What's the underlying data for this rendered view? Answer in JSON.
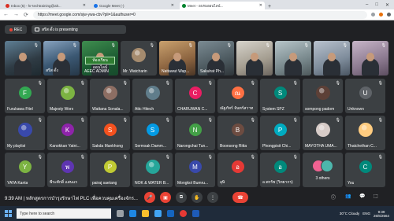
{
  "browser": {
    "tabs": [
      {
        "title": "Inbox (5) - hr-techtraining@alt...",
        "fav_color": "#d93025",
        "active": false
      },
      {
        "title": "Google Meet (-)",
        "fav_color": "#1a73e8",
        "active": false
      },
      {
        "title": "Meet - อบรมออนไลน์...",
        "fav_color": "#00832d",
        "active": true
      }
    ],
    "new_tab_label": "+",
    "window_controls": [
      "–",
      "□",
      "✕"
    ],
    "url": "https://meet.google.com/sjw-ywa-cbv?pli=1&authuser=0"
  },
  "presenting": {
    "rec_label": "REC",
    "presenter_text": "สรีส ดั้ง is presenting"
  },
  "grid": {
    "row1": [
      {
        "name": "",
        "video": "v1"
      },
      {
        "name": "สรีส ดั้ง",
        "video": "v2"
      },
      {
        "name": "AEEC ADMIN",
        "video": "v3",
        "banner": "ห้องเรียนออนไลน์"
      },
      {
        "name": "Mr. Watcharin",
        "avatar_letter": "",
        "photo_color": "#a58b6e"
      },
      {
        "name": "Nattawut Wap...",
        "video": "v4"
      },
      {
        "name": "Sakulrat Ph...",
        "video": "v5"
      },
      {
        "name": "",
        "video": "v6"
      },
      {
        "name": "",
        "video": "v7"
      },
      {
        "name": "",
        "video": "v8"
      },
      {
        "name": "",
        "video": "v9"
      }
    ],
    "row2": [
      {
        "name": "Furukawa Fitel",
        "avatar_letter": "F",
        "color": "#33a852"
      },
      {
        "name": "Majesty Worx",
        "photo_color": "#7cb342"
      },
      {
        "name": "Wattana Sonala...",
        "photo_color": "#8d6e63"
      },
      {
        "name": "Attc Hitech",
        "photo_color": "#607d8b"
      },
      {
        "name": "CHARUWAN C...",
        "avatar_letter": "C",
        "color": "#e91e63"
      },
      {
        "name": "ณัฐภัทร์ จันทร์สวาท",
        "avatar_letter": "ณ",
        "color": "#ff7043"
      },
      {
        "name": "System SPZ",
        "avatar_letter": "S",
        "color": "#00897b"
      },
      {
        "name": "sompong padom",
        "photo_color": "#5d4037"
      },
      {
        "name": "Unknown",
        "avatar_letter": "U",
        "color": "#5f6368"
      }
    ],
    "row3": [
      {
        "name": "My playlist",
        "photo_color": "#3949ab"
      },
      {
        "name": "Kanokkan Yatni...",
        "avatar_letter": "K",
        "color": "#8e24aa"
      },
      {
        "name": "Sakda Mankhong",
        "avatar_letter": "S",
        "color": "#f4511e"
      },
      {
        "name": "Sermsak Damm...",
        "avatar_letter": "S",
        "color": "#039be5"
      },
      {
        "name": "Narongchai Tun...",
        "avatar_letter": "N",
        "color": "#43a047"
      },
      {
        "name": "Boonsong Ritta",
        "avatar_letter": "B",
        "color": "#6d4c41"
      },
      {
        "name": "Phongpisit Chi...",
        "avatar_letter": "P",
        "color": "#00acc1"
      },
      {
        "name": "MAYOTHA UMA...",
        "photo_color": "#d7ccc8"
      },
      {
        "name": "Thatchethan C...",
        "photo_color": "#ffcc80"
      }
    ],
    "row4": [
      {
        "name": "YAYA Kanta",
        "avatar_letter": "Y",
        "color": "#7cb342"
      },
      {
        "name": "พีระศักดิ์ แสนแร",
        "avatar_letter": "พ",
        "color": "#5e35b1"
      },
      {
        "name": "pairaj saetang",
        "avatar_letter": "P",
        "color": "#c0ca33"
      },
      {
        "name": "NOK & WATER B...",
        "photo_color": "#26a69a"
      },
      {
        "name": "Mongkol Bumru...",
        "avatar_letter": "M",
        "color": "#3949ab"
      },
      {
        "name": "อุษิ",
        "avatar_letter": "อ",
        "color": "#e53935"
      },
      {
        "name": "อ.พรรัช (วิทยากร)",
        "avatar_letter": "อ",
        "color": "#00897b"
      },
      {
        "name": "3 others",
        "others": true
      },
      {
        "name": "You",
        "avatar_letter": "C",
        "color": "#00897b"
      }
    ]
  },
  "bottom": {
    "time_meeting": "9:39 AM | หลักสูตรการบำรุงรักษาไฟ PLC เพื่อควบคุมเครื่องจักร...",
    "controls": [
      "🎤",
      "▣",
      "⧉",
      "✋",
      "⋮"
    ],
    "end_icon": "☎",
    "right_controls": [
      "ⓘ",
      "👥",
      "💬",
      "⬚"
    ]
  },
  "taskbar": {
    "search_placeholder": "Type here to search",
    "weather": "30°C Cloudy",
    "time": "9:39",
    "date": "26/6/2564",
    "lang": "ENG"
  }
}
